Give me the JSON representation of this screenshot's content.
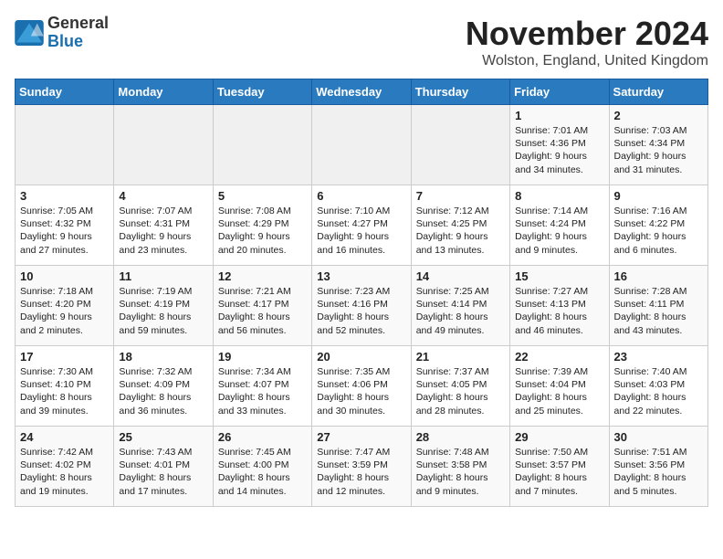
{
  "header": {
    "logo": {
      "line1": "General",
      "line2": "Blue"
    },
    "title": "November 2024",
    "location": "Wolston, England, United Kingdom"
  },
  "weekdays": [
    "Sunday",
    "Monday",
    "Tuesday",
    "Wednesday",
    "Thursday",
    "Friday",
    "Saturday"
  ],
  "weeks": [
    [
      {
        "day": "",
        "content": ""
      },
      {
        "day": "",
        "content": ""
      },
      {
        "day": "",
        "content": ""
      },
      {
        "day": "",
        "content": ""
      },
      {
        "day": "",
        "content": ""
      },
      {
        "day": "1",
        "content": "Sunrise: 7:01 AM\nSunset: 4:36 PM\nDaylight: 9 hours\nand 34 minutes."
      },
      {
        "day": "2",
        "content": "Sunrise: 7:03 AM\nSunset: 4:34 PM\nDaylight: 9 hours\nand 31 minutes."
      }
    ],
    [
      {
        "day": "3",
        "content": "Sunrise: 7:05 AM\nSunset: 4:32 PM\nDaylight: 9 hours\nand 27 minutes."
      },
      {
        "day": "4",
        "content": "Sunrise: 7:07 AM\nSunset: 4:31 PM\nDaylight: 9 hours\nand 23 minutes."
      },
      {
        "day": "5",
        "content": "Sunrise: 7:08 AM\nSunset: 4:29 PM\nDaylight: 9 hours\nand 20 minutes."
      },
      {
        "day": "6",
        "content": "Sunrise: 7:10 AM\nSunset: 4:27 PM\nDaylight: 9 hours\nand 16 minutes."
      },
      {
        "day": "7",
        "content": "Sunrise: 7:12 AM\nSunset: 4:25 PM\nDaylight: 9 hours\nand 13 minutes."
      },
      {
        "day": "8",
        "content": "Sunrise: 7:14 AM\nSunset: 4:24 PM\nDaylight: 9 hours\nand 9 minutes."
      },
      {
        "day": "9",
        "content": "Sunrise: 7:16 AM\nSunset: 4:22 PM\nDaylight: 9 hours\nand 6 minutes."
      }
    ],
    [
      {
        "day": "10",
        "content": "Sunrise: 7:18 AM\nSunset: 4:20 PM\nDaylight: 9 hours\nand 2 minutes."
      },
      {
        "day": "11",
        "content": "Sunrise: 7:19 AM\nSunset: 4:19 PM\nDaylight: 8 hours\nand 59 minutes."
      },
      {
        "day": "12",
        "content": "Sunrise: 7:21 AM\nSunset: 4:17 PM\nDaylight: 8 hours\nand 56 minutes."
      },
      {
        "day": "13",
        "content": "Sunrise: 7:23 AM\nSunset: 4:16 PM\nDaylight: 8 hours\nand 52 minutes."
      },
      {
        "day": "14",
        "content": "Sunrise: 7:25 AM\nSunset: 4:14 PM\nDaylight: 8 hours\nand 49 minutes."
      },
      {
        "day": "15",
        "content": "Sunrise: 7:27 AM\nSunset: 4:13 PM\nDaylight: 8 hours\nand 46 minutes."
      },
      {
        "day": "16",
        "content": "Sunrise: 7:28 AM\nSunset: 4:11 PM\nDaylight: 8 hours\nand 43 minutes."
      }
    ],
    [
      {
        "day": "17",
        "content": "Sunrise: 7:30 AM\nSunset: 4:10 PM\nDaylight: 8 hours\nand 39 minutes."
      },
      {
        "day": "18",
        "content": "Sunrise: 7:32 AM\nSunset: 4:09 PM\nDaylight: 8 hours\nand 36 minutes."
      },
      {
        "day": "19",
        "content": "Sunrise: 7:34 AM\nSunset: 4:07 PM\nDaylight: 8 hours\nand 33 minutes."
      },
      {
        "day": "20",
        "content": "Sunrise: 7:35 AM\nSunset: 4:06 PM\nDaylight: 8 hours\nand 30 minutes."
      },
      {
        "day": "21",
        "content": "Sunrise: 7:37 AM\nSunset: 4:05 PM\nDaylight: 8 hours\nand 28 minutes."
      },
      {
        "day": "22",
        "content": "Sunrise: 7:39 AM\nSunset: 4:04 PM\nDaylight: 8 hours\nand 25 minutes."
      },
      {
        "day": "23",
        "content": "Sunrise: 7:40 AM\nSunset: 4:03 PM\nDaylight: 8 hours\nand 22 minutes."
      }
    ],
    [
      {
        "day": "24",
        "content": "Sunrise: 7:42 AM\nSunset: 4:02 PM\nDaylight: 8 hours\nand 19 minutes."
      },
      {
        "day": "25",
        "content": "Sunrise: 7:43 AM\nSunset: 4:01 PM\nDaylight: 8 hours\nand 17 minutes."
      },
      {
        "day": "26",
        "content": "Sunrise: 7:45 AM\nSunset: 4:00 PM\nDaylight: 8 hours\nand 14 minutes."
      },
      {
        "day": "27",
        "content": "Sunrise: 7:47 AM\nSunset: 3:59 PM\nDaylight: 8 hours\nand 12 minutes."
      },
      {
        "day": "28",
        "content": "Sunrise: 7:48 AM\nSunset: 3:58 PM\nDaylight: 8 hours\nand 9 minutes."
      },
      {
        "day": "29",
        "content": "Sunrise: 7:50 AM\nSunset: 3:57 PM\nDaylight: 8 hours\nand 7 minutes."
      },
      {
        "day": "30",
        "content": "Sunrise: 7:51 AM\nSunset: 3:56 PM\nDaylight: 8 hours\nand 5 minutes."
      }
    ]
  ]
}
